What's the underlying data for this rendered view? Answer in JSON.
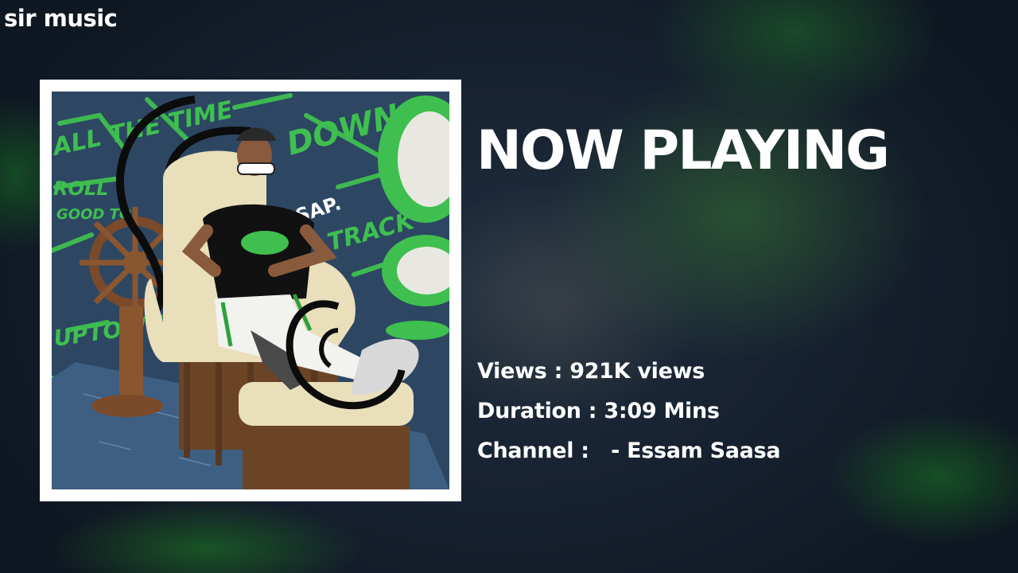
{
  "brand": {
    "name": "sir music"
  },
  "now_playing": {
    "heading": "NOW PLAYING",
    "views_label": "Views : ",
    "views_value": "921K views",
    "duration_label": "Duration : ",
    "duration_value": "3:09 Mins",
    "channel_label": "Channel :  ",
    "channel_value": " - Essam Saasa"
  },
  "album_art": {
    "graffiti_words": [
      "ALL THE TIME",
      "GOOD TO",
      "DOWN",
      "ROLL",
      "TRACK",
      "UPTOWN",
      "SAP."
    ],
    "accent_color": "#3fbf4f",
    "backdrop_color": "#2d4763"
  }
}
